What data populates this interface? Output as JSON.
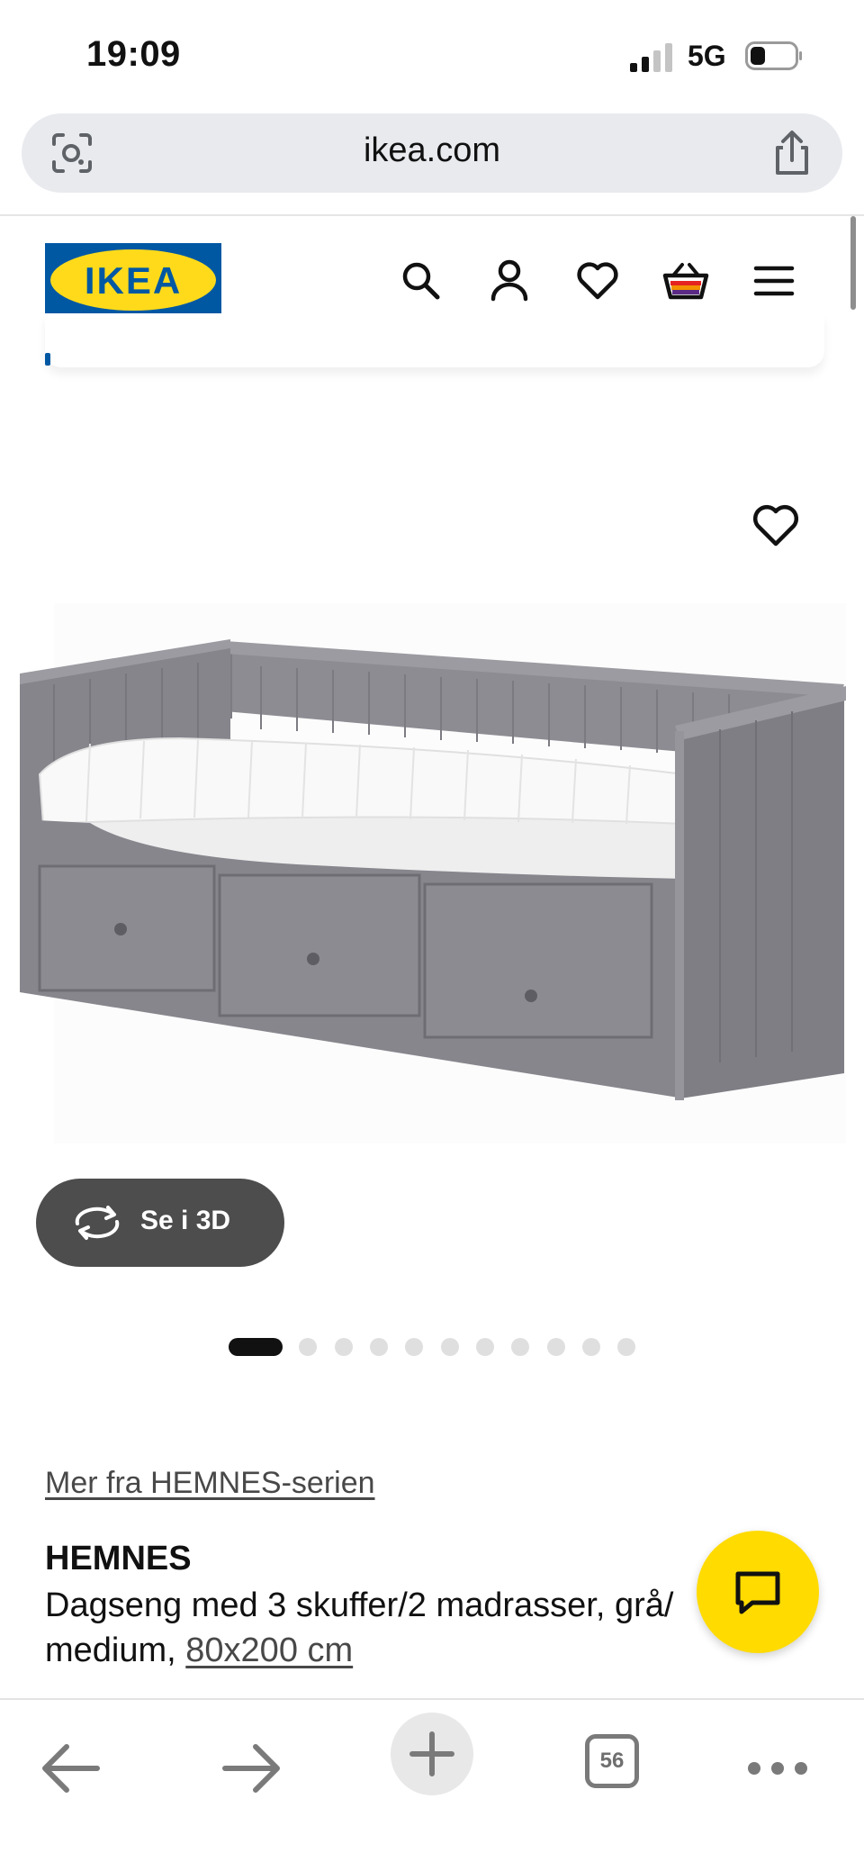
{
  "status_bar": {
    "time": "19:09",
    "network": "5G",
    "icons": [
      "signal-icon",
      "battery-icon"
    ]
  },
  "browser": {
    "url": "ikea.com",
    "left_icon": "camera-search-icon",
    "right_icon": "share-icon"
  },
  "header": {
    "logo_text": "IKEA",
    "icons": [
      "search-icon",
      "account-icon",
      "favourites-icon",
      "basket-icon",
      "menu-icon"
    ],
    "colors": {
      "logo_blue": "#0058a3",
      "logo_yellow": "#ffda1a"
    }
  },
  "product": {
    "image_alt": "HEMNES dagseng grå",
    "view_3d_label": "Se i 3D",
    "carousel": {
      "total": 12,
      "active": 1
    },
    "series_link": "Mer fra HEMNES-serien",
    "name": "HEMNES",
    "description_line1": "Dagseng med 3 skuffer/2 madrasser, grå/",
    "description_line2_prefix": "medium, ",
    "size_link": "80x200 cm"
  },
  "chat": {
    "icon": "chat-icon",
    "color": "#ffdb00"
  },
  "toolbar": {
    "tabs_count": "56",
    "icons": [
      "back-icon",
      "forward-icon",
      "new-tab-icon",
      "tabs-icon",
      "more-icon"
    ]
  }
}
